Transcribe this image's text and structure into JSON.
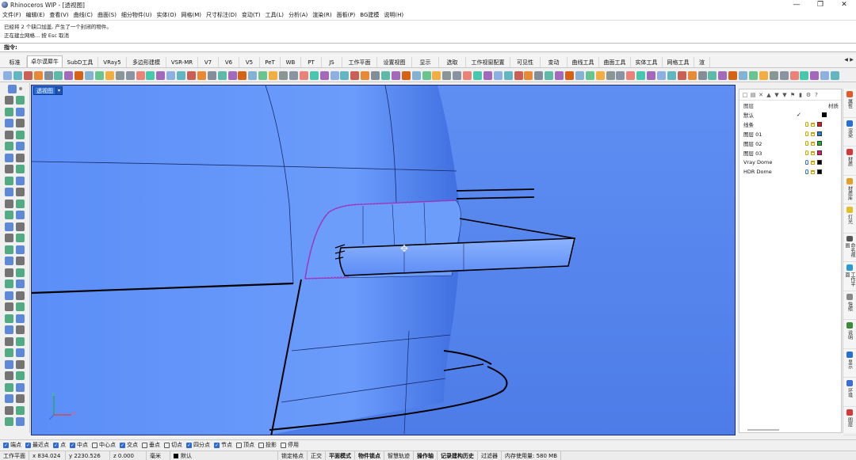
{
  "window": {
    "title": "Rhinoceros WIP - [透视图]",
    "controls": [
      "—",
      "❐",
      "✕"
    ]
  },
  "menu": [
    "文件(F)",
    "编辑(E)",
    "查看(V)",
    "曲线(C)",
    "曲面(S)",
    "细分物件(U)",
    "实体(O)",
    "网格(M)",
    "尺寸标注(D)",
    "变动(T)",
    "工具(L)",
    "分析(A)",
    "渲染(R)",
    "面板(P)",
    "BG建模",
    "说明(H)"
  ],
  "history": [
    "已经将 2 个缺口加盖, 产生了一个封闭的物件。",
    "正在建立网格... 按 Esc 取消"
  ],
  "command": {
    "label": "指令:"
  },
  "tabs": [
    {
      "label": "标准",
      "active": false
    },
    {
      "label": "卓尔谟犀牛",
      "active": true
    },
    {
      "label": "SubD工具",
      "active": false
    },
    {
      "label": "VRay5",
      "active": false
    },
    {
      "label": "多边形建模",
      "active": false
    },
    {
      "label": "VSR-MR",
      "active": false
    },
    {
      "label": "V7",
      "active": false
    },
    {
      "label": "V6",
      "active": false
    },
    {
      "label": "V5",
      "active": false
    },
    {
      "label": "PeT",
      "active": false
    },
    {
      "label": "WB",
      "active": false
    },
    {
      "label": "PT",
      "active": false
    },
    {
      "label": "JS",
      "active": false
    },
    {
      "label": "工作平面",
      "active": false
    },
    {
      "label": "设置视图",
      "active": false
    },
    {
      "label": "显示",
      "active": false
    },
    {
      "label": "选取",
      "active": false
    },
    {
      "label": "工作视窗配置",
      "active": false
    },
    {
      "label": "可见性",
      "active": false
    },
    {
      "label": "变动",
      "active": false
    },
    {
      "label": "曲线工具",
      "active": false
    },
    {
      "label": "曲面工具",
      "active": false
    },
    {
      "label": "实体工具",
      "active": false
    },
    {
      "label": "网格工具",
      "active": false
    },
    {
      "label": "渲",
      "active": false
    }
  ],
  "tab_arrows": [
    "◀",
    "▶"
  ],
  "viewport": {
    "label": "透视图",
    "menu_arrow": "▾",
    "axis_z": "z",
    "axis_x": "x"
  },
  "panel": {
    "header_label": "图层",
    "header_material": "材质",
    "toolbar_icons": [
      "□",
      "▤",
      "✕",
      "▲",
      "▼",
      "▼",
      "⚑",
      "▮",
      "⚙",
      "?"
    ],
    "layers": [
      {
        "name": "默认",
        "current": true,
        "check": "✓",
        "swatch": "#000000"
      },
      {
        "name": "线条",
        "current": false,
        "swatch": "#e8101a"
      },
      {
        "name": "图层 01",
        "current": false,
        "swatch": "#1e7de0"
      },
      {
        "name": "图层 02",
        "current": false,
        "swatch": "#1db31d"
      },
      {
        "name": "图层 03",
        "current": false,
        "swatch": "#e0187e"
      },
      {
        "name": "Vray Dome",
        "current": false,
        "swatch": "#000000"
      },
      {
        "name": "HDR Dome",
        "current": false,
        "swatch": "#000000"
      }
    ]
  },
  "right_strip": [
    "属性",
    "渲染",
    "材质",
    "材质库",
    "灯光",
    "命名视图",
    "工作平面",
    "快照",
    "说明",
    "显示",
    "环境",
    "图层"
  ],
  "osnaps": [
    {
      "label": "端点",
      "on": true
    },
    {
      "label": "最近点",
      "on": true
    },
    {
      "label": "点",
      "on": true
    },
    {
      "label": "中点",
      "on": true
    },
    {
      "label": "中心点",
      "on": false
    },
    {
      "label": "交点",
      "on": true
    },
    {
      "label": "垂点",
      "on": false
    },
    {
      "label": "切点",
      "on": false
    },
    {
      "label": "四分点",
      "on": true
    },
    {
      "label": "节点",
      "on": true
    },
    {
      "label": "顶点",
      "on": false
    },
    {
      "label": "投影",
      "on": false
    },
    {
      "label": "停用",
      "on": false
    }
  ],
  "status": {
    "cplane": "工作平面",
    "x": "x 834.024",
    "y": "y 2230.526",
    "z": "z 0.000",
    "unit": "毫米",
    "layer": "默认",
    "items": [
      "锁定格点",
      "正交",
      "平面模式",
      "物件锁点",
      "智慧轨迹",
      "操作轴",
      "记录建构历史",
      "过滤器",
      "内存使用量: 580 MB"
    ]
  }
}
